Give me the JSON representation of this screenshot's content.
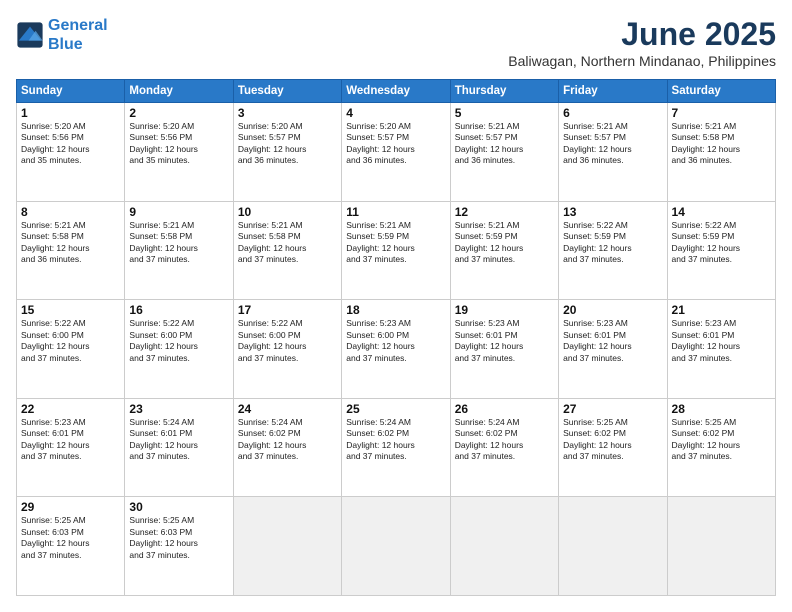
{
  "logo": {
    "line1": "General",
    "line2": "Blue"
  },
  "title": "June 2025",
  "subtitle": "Baliwagan, Northern Mindanao, Philippines",
  "weekdays": [
    "Sunday",
    "Monday",
    "Tuesday",
    "Wednesday",
    "Thursday",
    "Friday",
    "Saturday"
  ],
  "days": [
    {
      "num": "",
      "info": ""
    },
    {
      "num": "2",
      "info": "Sunrise: 5:20 AM\nSunset: 5:56 PM\nDaylight: 12 hours\nand 35 minutes."
    },
    {
      "num": "3",
      "info": "Sunrise: 5:20 AM\nSunset: 5:57 PM\nDaylight: 12 hours\nand 36 minutes."
    },
    {
      "num": "4",
      "info": "Sunrise: 5:20 AM\nSunset: 5:57 PM\nDaylight: 12 hours\nand 36 minutes."
    },
    {
      "num": "5",
      "info": "Sunrise: 5:21 AM\nSunset: 5:57 PM\nDaylight: 12 hours\nand 36 minutes."
    },
    {
      "num": "6",
      "info": "Sunrise: 5:21 AM\nSunset: 5:57 PM\nDaylight: 12 hours\nand 36 minutes."
    },
    {
      "num": "7",
      "info": "Sunrise: 5:21 AM\nSunset: 5:58 PM\nDaylight: 12 hours\nand 36 minutes."
    },
    {
      "num": "8",
      "info": "Sunrise: 5:21 AM\nSunset: 5:58 PM\nDaylight: 12 hours\nand 36 minutes."
    },
    {
      "num": "9",
      "info": "Sunrise: 5:21 AM\nSunset: 5:58 PM\nDaylight: 12 hours\nand 37 minutes."
    },
    {
      "num": "10",
      "info": "Sunrise: 5:21 AM\nSunset: 5:58 PM\nDaylight: 12 hours\nand 37 minutes."
    },
    {
      "num": "11",
      "info": "Sunrise: 5:21 AM\nSunset: 5:59 PM\nDaylight: 12 hours\nand 37 minutes."
    },
    {
      "num": "12",
      "info": "Sunrise: 5:21 AM\nSunset: 5:59 PM\nDaylight: 12 hours\nand 37 minutes."
    },
    {
      "num": "13",
      "info": "Sunrise: 5:22 AM\nSunset: 5:59 PM\nDaylight: 12 hours\nand 37 minutes."
    },
    {
      "num": "14",
      "info": "Sunrise: 5:22 AM\nSunset: 5:59 PM\nDaylight: 12 hours\nand 37 minutes."
    },
    {
      "num": "15",
      "info": "Sunrise: 5:22 AM\nSunset: 6:00 PM\nDaylight: 12 hours\nand 37 minutes."
    },
    {
      "num": "16",
      "info": "Sunrise: 5:22 AM\nSunset: 6:00 PM\nDaylight: 12 hours\nand 37 minutes."
    },
    {
      "num": "17",
      "info": "Sunrise: 5:22 AM\nSunset: 6:00 PM\nDaylight: 12 hours\nand 37 minutes."
    },
    {
      "num": "18",
      "info": "Sunrise: 5:23 AM\nSunset: 6:00 PM\nDaylight: 12 hours\nand 37 minutes."
    },
    {
      "num": "19",
      "info": "Sunrise: 5:23 AM\nSunset: 6:01 PM\nDaylight: 12 hours\nand 37 minutes."
    },
    {
      "num": "20",
      "info": "Sunrise: 5:23 AM\nSunset: 6:01 PM\nDaylight: 12 hours\nand 37 minutes."
    },
    {
      "num": "21",
      "info": "Sunrise: 5:23 AM\nSunset: 6:01 PM\nDaylight: 12 hours\nand 37 minutes."
    },
    {
      "num": "22",
      "info": "Sunrise: 5:23 AM\nSunset: 6:01 PM\nDaylight: 12 hours\nand 37 minutes."
    },
    {
      "num": "23",
      "info": "Sunrise: 5:24 AM\nSunset: 6:01 PM\nDaylight: 12 hours\nand 37 minutes."
    },
    {
      "num": "24",
      "info": "Sunrise: 5:24 AM\nSunset: 6:02 PM\nDaylight: 12 hours\nand 37 minutes."
    },
    {
      "num": "25",
      "info": "Sunrise: 5:24 AM\nSunset: 6:02 PM\nDaylight: 12 hours\nand 37 minutes."
    },
    {
      "num": "26",
      "info": "Sunrise: 5:24 AM\nSunset: 6:02 PM\nDaylight: 12 hours\nand 37 minutes."
    },
    {
      "num": "27",
      "info": "Sunrise: 5:25 AM\nSunset: 6:02 PM\nDaylight: 12 hours\nand 37 minutes."
    },
    {
      "num": "28",
      "info": "Sunrise: 5:25 AM\nSunset: 6:02 PM\nDaylight: 12 hours\nand 37 minutes."
    },
    {
      "num": "29",
      "info": "Sunrise: 5:25 AM\nSunset: 6:03 PM\nDaylight: 12 hours\nand 37 minutes."
    },
    {
      "num": "30",
      "info": "Sunrise: 5:25 AM\nSunset: 6:03 PM\nDaylight: 12 hours\nand 37 minutes."
    },
    {
      "num": "",
      "info": ""
    },
    {
      "num": "",
      "info": ""
    },
    {
      "num": "",
      "info": ""
    },
    {
      "num": "",
      "info": ""
    },
    {
      "num": "",
      "info": ""
    }
  ],
  "day1": {
    "num": "1",
    "info": "Sunrise: 5:20 AM\nSunset: 5:56 PM\nDaylight: 12 hours\nand 35 minutes."
  }
}
